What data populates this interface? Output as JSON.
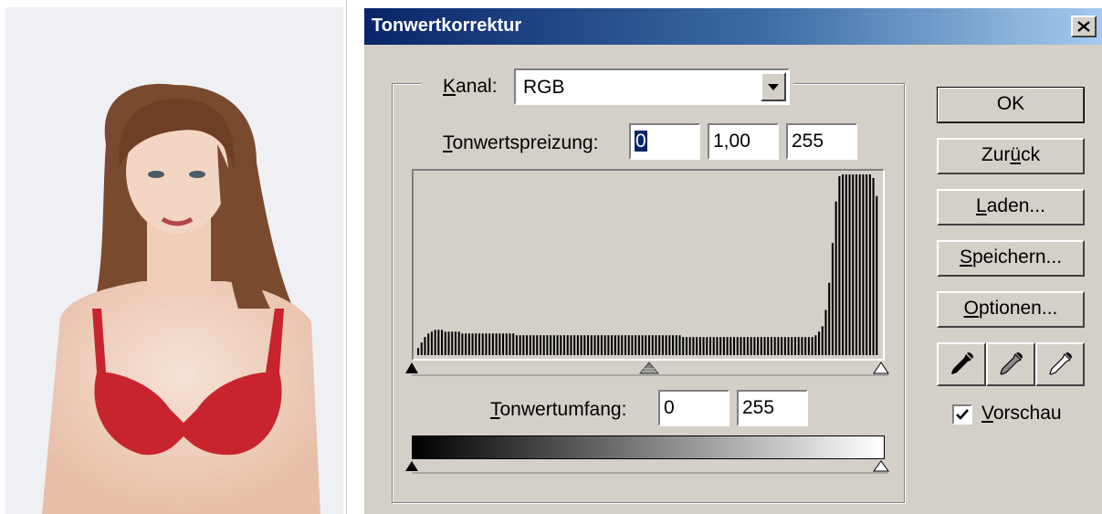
{
  "dialog": {
    "title": "Tonwertkorrektur",
    "channel": {
      "label_underlined": "K",
      "label_rest": "anal:",
      "selected": "RGB"
    },
    "input_levels": {
      "label_underlined": "T",
      "label_rest": "onwertspreizung:",
      "black": "0",
      "gamma": "1,00",
      "white": "255"
    },
    "output_levels": {
      "label_underlined": "T",
      "label_rest": "onwertumfang:",
      "black": "0",
      "white": "255"
    },
    "buttons": {
      "ok": "OK",
      "reset_underlined": "ü",
      "reset_pre": "Zur",
      "reset_post": "ck",
      "load_underlined": "L",
      "load_rest": "aden...",
      "save_underlined": "S",
      "save_rest": "peichern...",
      "options_underlined": "O",
      "options_rest": "ptionen..."
    },
    "preview": {
      "label_underlined": "V",
      "label_rest": "orschau",
      "checked": true
    },
    "icons": {
      "close": "close-icon",
      "dropdown": "chevron-down-icon",
      "black_eyedropper": "eyedropper-black-icon",
      "gray_eyedropper": "eyedropper-gray-icon",
      "white_eyedropper": "eyedropper-white-icon"
    }
  },
  "chart_data": {
    "type": "bar",
    "x_range": [
      0,
      255
    ],
    "description_values": "relative pixel counts per tonal level (0 = empty, 1 = full height)",
    "values": [
      0.04,
      0.07,
      0.1,
      0.12,
      0.13,
      0.14,
      0.14,
      0.14,
      0.13,
      0.13,
      0.13,
      0.13,
      0.13,
      0.12,
      0.12,
      0.12,
      0.12,
      0.12,
      0.12,
      0.12,
      0.12,
      0.12,
      0.12,
      0.12,
      0.12,
      0.12,
      0.12,
      0.12,
      0.12,
      0.11,
      0.11,
      0.11,
      0.11,
      0.11,
      0.11,
      0.11,
      0.11,
      0.11,
      0.11,
      0.11,
      0.11,
      0.11,
      0.11,
      0.11,
      0.11,
      0.11,
      0.11,
      0.11,
      0.11,
      0.11,
      0.11,
      0.11,
      0.11,
      0.11,
      0.11,
      0.11,
      0.11,
      0.11,
      0.11,
      0.11,
      0.11,
      0.11,
      0.11,
      0.11,
      0.11,
      0.11,
      0.11,
      0.11,
      0.11,
      0.11,
      0.11,
      0.11,
      0.11,
      0.11,
      0.11,
      0.11,
      0.11,
      0.11,
      0.1,
      0.1,
      0.1,
      0.1,
      0.1,
      0.1,
      0.1,
      0.1,
      0.1,
      0.1,
      0.1,
      0.1,
      0.1,
      0.1,
      0.1,
      0.1,
      0.1,
      0.1,
      0.1,
      0.1,
      0.1,
      0.1,
      0.1,
      0.1,
      0.1,
      0.1,
      0.1,
      0.1,
      0.1,
      0.1,
      0.1,
      0.1,
      0.1,
      0.1,
      0.1,
      0.1,
      0.1,
      0.1,
      0.1,
      0.11,
      0.13,
      0.16,
      0.25,
      0.4,
      0.62,
      0.85,
      0.99,
      1,
      1,
      1,
      1,
      1,
      1,
      1,
      1,
      1,
      0.98,
      0.88
    ]
  }
}
